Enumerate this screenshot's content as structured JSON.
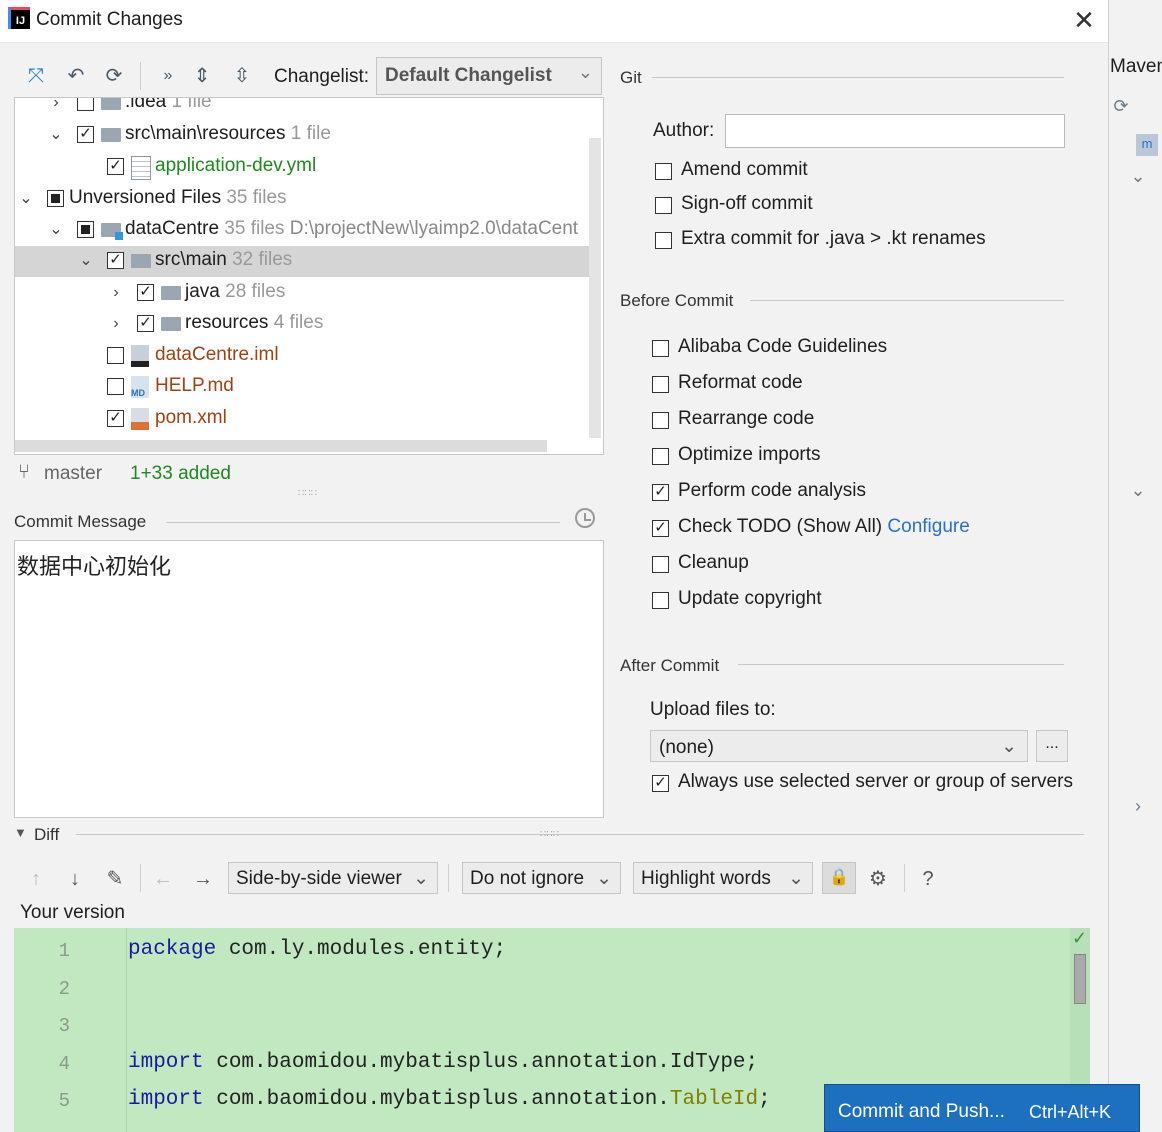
{
  "window": {
    "title": "Commit Changes",
    "close_glyph": "✕",
    "app_icon_text": "IJ"
  },
  "right_strip": {
    "title": "Maven"
  },
  "toolbar": {
    "changelist_label": "Changelist:",
    "changelist_value": "Default Changelist",
    "icons": [
      "diff-icon",
      "undo-icon",
      "refresh-icon",
      "more-icon",
      "expand-all-icon",
      "collapse-all-icon"
    ]
  },
  "tree": {
    "rows": [
      {
        "name": ".idea",
        "count": "1 file"
      },
      {
        "name": "src\\main\\resources",
        "count": "1 file"
      },
      {
        "name": "application-dev.yml"
      },
      {
        "name": "Unversioned Files",
        "count": "35 files"
      },
      {
        "name": "dataCentre",
        "count": "35 files",
        "path": "D:\\projectNew\\lyaimp2.0\\dataCent"
      },
      {
        "name": "src\\main",
        "count": "32 files"
      },
      {
        "name": "java",
        "count": "28 files"
      },
      {
        "name": "resources",
        "count": "4 files"
      },
      {
        "name": "dataCentre.iml"
      },
      {
        "name": "HELP.md"
      },
      {
        "name": "pom.xml"
      }
    ]
  },
  "status": {
    "branch": "master",
    "added": "1+33 added"
  },
  "commit_message": {
    "label": "Commit Message",
    "text": "数据中心初始化"
  },
  "git": {
    "section": "Git",
    "author_label": "Author:",
    "author_value": "",
    "options": [
      "Amend commit",
      "Sign-off commit",
      "Extra commit for .java > .kt renames"
    ]
  },
  "before_commit": {
    "section": "Before Commit",
    "options": [
      {
        "label": "Alibaba Code Guidelines",
        "checked": false
      },
      {
        "label": "Reformat code",
        "checked": false
      },
      {
        "label": "Rearrange code",
        "checked": false
      },
      {
        "label": "Optimize imports",
        "checked": false
      },
      {
        "label": "Perform code analysis",
        "checked": true
      },
      {
        "label": "Check TODO (Show All)",
        "checked": true,
        "link": "Configure"
      },
      {
        "label": "Cleanup",
        "checked": false
      },
      {
        "label": "Update copyright",
        "checked": false
      }
    ]
  },
  "after_commit": {
    "section": "After Commit",
    "upload_label": "Upload files to:",
    "upload_value": "(none)",
    "browse_label": "...",
    "always_label": "Always use selected server or group of servers"
  },
  "diff": {
    "label": "Diff",
    "viewer": "Side-by-side viewer",
    "ignore": "Do not ignore",
    "highlight": "Highlight words",
    "help": "?",
    "your_version": "Your version",
    "lines": [
      {
        "n": "1",
        "kw": "package",
        "rest": " com.ly.modules.entity;"
      },
      {
        "n": "2",
        "kw": "",
        "rest": ""
      },
      {
        "n": "3",
        "kw": "",
        "rest": ""
      },
      {
        "n": "4",
        "kw": "import",
        "rest": " com.baomidou.mybatisplus.annotation.",
        "tail": "IdType;"
      },
      {
        "n": "5",
        "kw": "import",
        "rest": " com.baomidou.mybatisplus.annotation.",
        "ann": "TableId",
        "tail2": ";"
      }
    ]
  },
  "commit_button": {
    "label": "Commit and Push...",
    "shortcut": "Ctrl+Alt+K"
  },
  "colors": {
    "accent": "#1d6fc0",
    "added_green": "#1b8b1b",
    "unversioned_brown": "#a14212",
    "diff_bg": "#c1e8c1"
  }
}
